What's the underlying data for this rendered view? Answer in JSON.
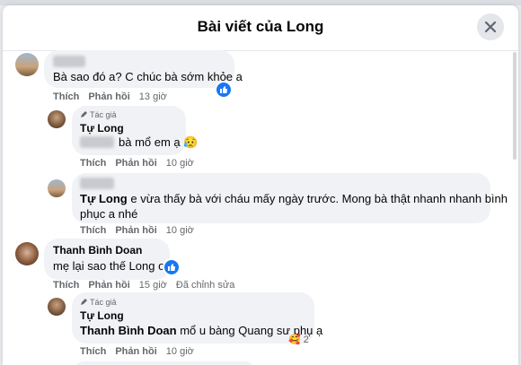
{
  "header": {
    "title": "Bài viết của Long"
  },
  "c1": {
    "text": "Bà sao đó a? C chúc bà sớm khỏe a",
    "like": "Thích",
    "reply": "Phản hồi",
    "time": "13 giờ"
  },
  "r1": {
    "badge": "Tác giả",
    "author": "Tự Long",
    "text": "bà mổ em ạ",
    "emoji": "😥",
    "like": "Thích",
    "reply": "Phản hồi",
    "time": "10 giờ"
  },
  "c2": {
    "mention": "Tự Long",
    "line1": " e vừa thấy bà với cháu mấy ngày trước. Mong bà thật nhanh nhanh bình",
    "line2": "phục a nhé",
    "like": "Thích",
    "reply": "Phản hồi",
    "time": "10 giờ"
  },
  "c3": {
    "author": "Thanh Bình Doan",
    "text": "mẹ lại sao thế Long ơi",
    "like": "Thích",
    "reply": "Phản hồi",
    "time": "15 giờ",
    "edited": "Đã chỉnh sửa"
  },
  "r2": {
    "badge": "Tác giả",
    "author": "Tự Long",
    "mention": "Thanh Bình Doan",
    "text": " mổ u bàng Quang sư phụ ạ",
    "like": "Thích",
    "reply": "Phản hồi",
    "time": "10 giờ",
    "reaction_emoji": "🥰",
    "reaction_count": "2"
  }
}
